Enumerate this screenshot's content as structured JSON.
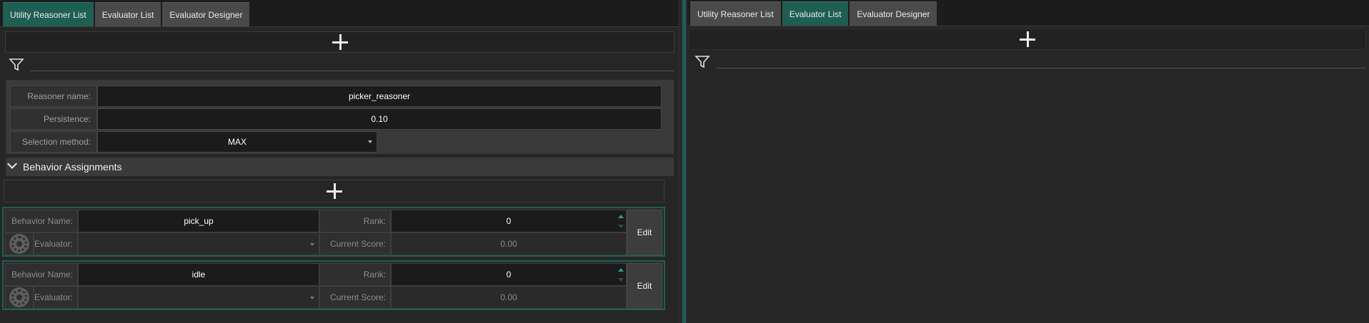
{
  "left": {
    "tabs": [
      {
        "label": "Utility Reasoner List",
        "active": true
      },
      {
        "label": "Evaluator List",
        "active": false
      },
      {
        "label": "Evaluator Designer",
        "active": false
      }
    ],
    "filter_placeholder": "",
    "properties": {
      "reasoner_name_label": "Reasoner name:",
      "reasoner_name_value": "picker_reasoner",
      "persistence_label": "Persistence:",
      "persistence_value": "0.10",
      "selection_method_label": "Selection method:",
      "selection_method_value": "MAX"
    },
    "section_title": "Behavior Assignments",
    "behaviors": [
      {
        "name_label": "Behavior Name:",
        "name": "pick_up",
        "rank_label": "Rank:",
        "rank": "0",
        "evaluator_label": "Evaluator:",
        "evaluator": "",
        "score_label": "Current Score:",
        "score": "0.00",
        "edit_label": "Edit"
      },
      {
        "name_label": "Behavior Name:",
        "name": "idle",
        "rank_label": "Rank:",
        "rank": "0",
        "evaluator_label": "Evaluator:",
        "evaluator": "",
        "score_label": "Current Score:",
        "score": "0.00",
        "edit_label": "Edit"
      }
    ]
  },
  "right": {
    "tabs": [
      {
        "label": "Utility Reasoner List",
        "active": false
      },
      {
        "label": "Evaluator List",
        "active": true
      },
      {
        "label": "Evaluator Designer",
        "active": false
      }
    ],
    "filter_placeholder": ""
  },
  "icons": {
    "add": "plus-icon",
    "filter": "filter-funnel-icon",
    "collapse": "chevron-down-icon",
    "gear": "gear-icon"
  },
  "colors": {
    "accent": "#1f5e53",
    "tab_inactive": "#4a4a4a",
    "background": "#262626"
  }
}
